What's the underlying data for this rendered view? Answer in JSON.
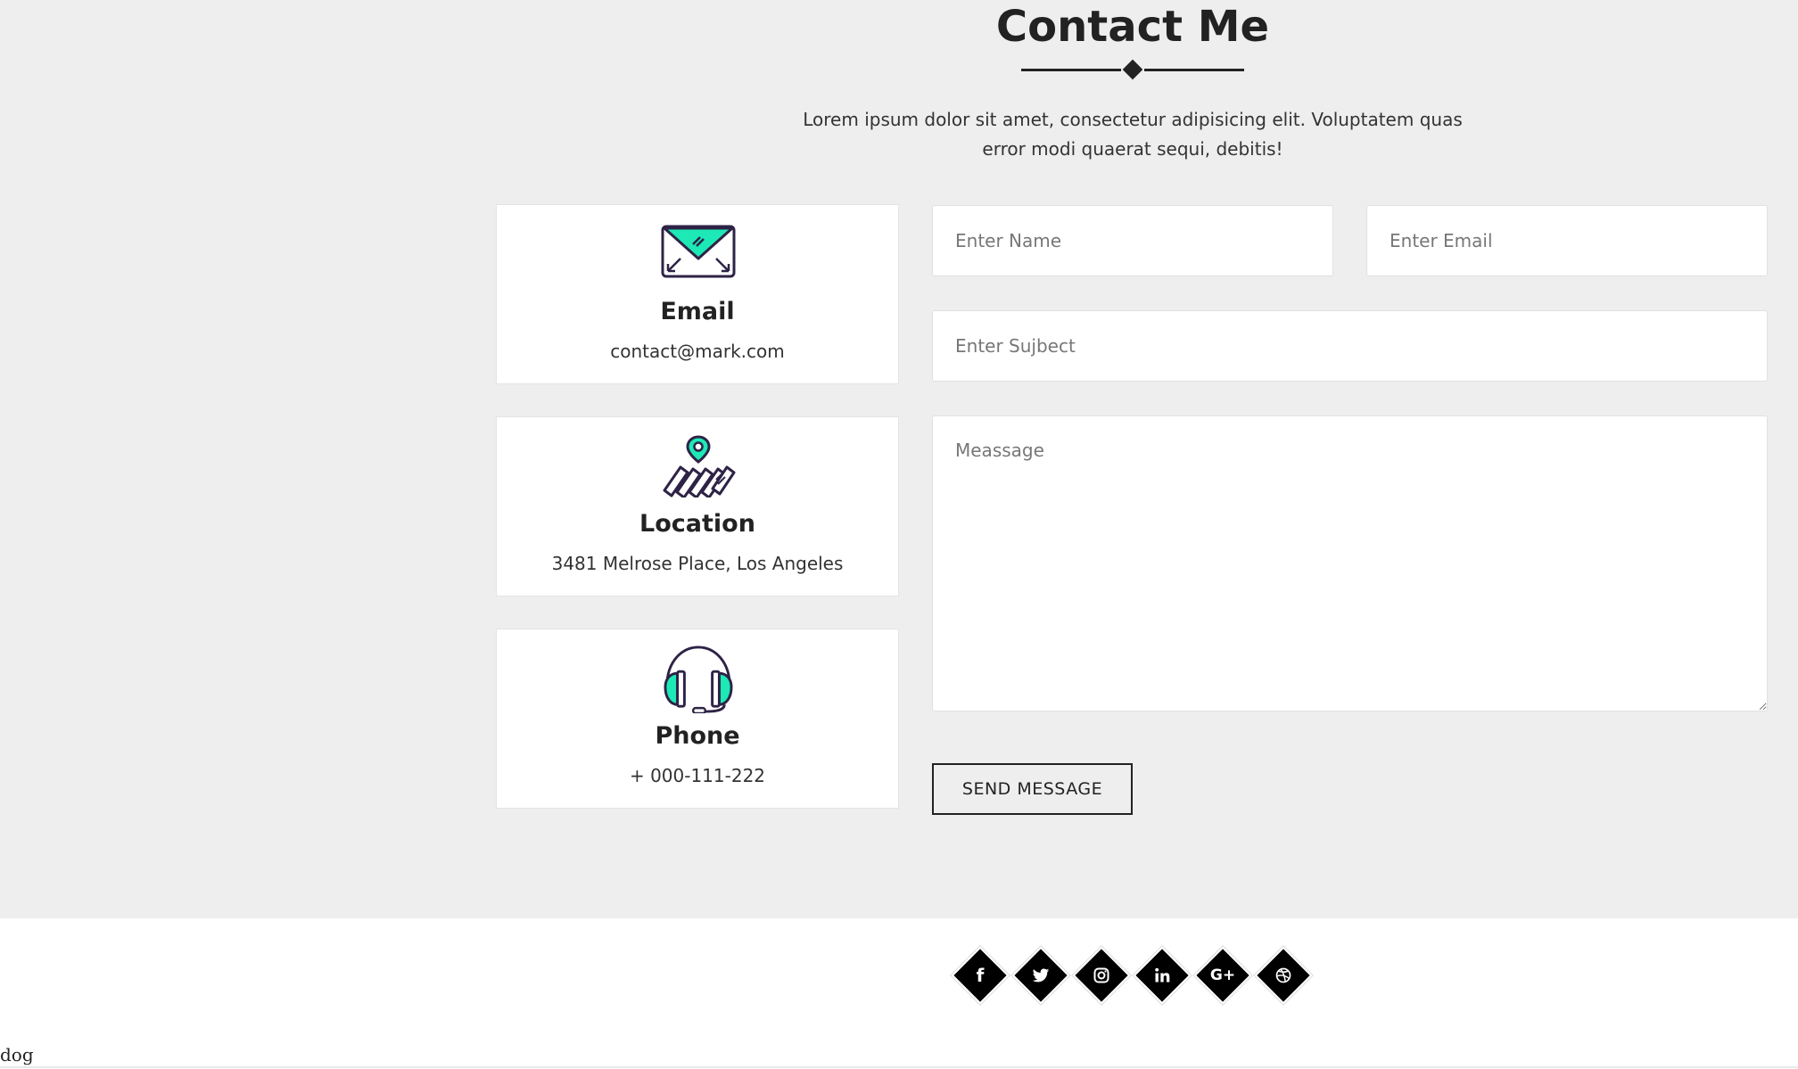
{
  "page": {
    "title": "Contact Me",
    "intro": "Lorem ipsum dolor sit amet, consectetur adipisicing elit. Voluptatem quas error modi quaerat sequi, debitis!"
  },
  "cards": [
    {
      "title": "Email",
      "value": "contact@mark.com",
      "icon": "envelope-icon"
    },
    {
      "title": "Location",
      "value": "3481 Melrose Place, Los Angeles",
      "icon": "map-pin-icon"
    },
    {
      "title": "Phone",
      "value": "+ 000-111-222",
      "icon": "headset-icon"
    }
  ],
  "form": {
    "name_placeholder": "Enter Name",
    "email_placeholder": "Enter Email",
    "subject_placeholder": "Enter Sujbect",
    "message_placeholder": "Meassage",
    "send_label": "SEND MESSAGE"
  },
  "social": {
    "facebook": "f",
    "googleplus": "G+",
    "icons": [
      "facebook-icon",
      "twitter-icon",
      "instagram-icon",
      "linkedin-icon",
      "google-plus-icon",
      "dribbble-icon"
    ]
  },
  "footer": {
    "note": "dog"
  },
  "colors": {
    "accent": "#1de9b6",
    "icon_stroke": "#2e2346",
    "background": "#eeeeee",
    "text": "#222222"
  }
}
